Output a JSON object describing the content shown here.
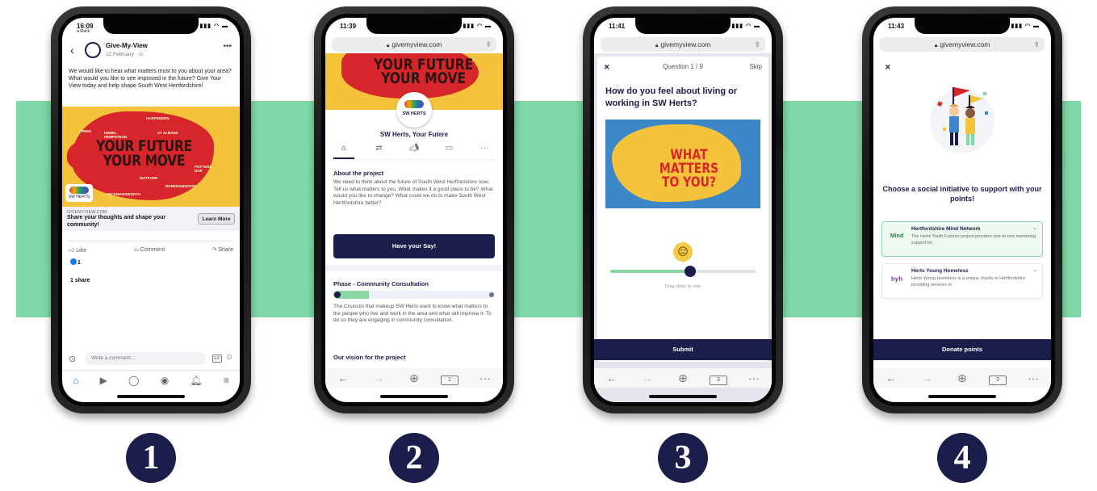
{
  "steps": [
    "1",
    "2",
    "3",
    "4"
  ],
  "phone1": {
    "time": "16:09",
    "back_app": "◂ Slack",
    "page_name": "Give-My-View",
    "post_date": "12 February · ⊙",
    "post_text": "We would like to hear what matters most to you about your area? What would you like to see improved in the future? Give Your View today and help shape South West Hertfordshire!",
    "image_slogan": "YOUR FUTURE\nYOUR MOVE",
    "towns": [
      "TRING",
      "HEMEL HEMPSTEAD",
      "HARPENDEN",
      "ST ALBANS",
      "WATFORD",
      "POTTERS BAR",
      "BOREHAMWOOD",
      "RICKMANSWORTH"
    ],
    "logo_text": "SW HERTS",
    "link_domain": "GIVEMYVIEW.COM",
    "link_title": "Share your thoughts and shape your community!",
    "learn_more": "Learn More",
    "actions": [
      "Like",
      "Comment",
      "Share"
    ],
    "reactions_count": "1",
    "shares": "1 share",
    "comment_placeholder": "Write a comment...",
    "gif_label": "GIF"
  },
  "phone2": {
    "time": "11:39",
    "url": "givemyview.com",
    "banner_slogan": "YOUR FUTURE\nYOUR MOVE",
    "logo_text": "SW HERTS",
    "project_title": "SW Herts, Your Futere",
    "about_heading": "About the project",
    "about_text": "We need to think about the future of South West Hertfordshire now. Tell us what matters to you. What makes it a good place to be? What would you like to change? What could we do to make South West Hertfordshire better?",
    "cta": "Have your Say!",
    "phase_heading": "Phase - Community Consultation",
    "phase_progress": 0.22,
    "phase_text": "The Councils that makeup SW Herts want to know what matters to the people who live and work in the area and what will improve it. To do so they are engaging in community consultation.",
    "vision_heading": "Our vision for the project",
    "tab_count": "1"
  },
  "phone3": {
    "time": "11:41",
    "url": "givemyview.com",
    "close": "✕",
    "question_number": "Question 1 / 9",
    "skip": "Skip",
    "question": "How do you feel about living or working in SW Herts?",
    "image_text": "WHAT MATTERS\nTO YOU?",
    "slider_value": 0.55,
    "slider_hint": "Drag slider to vote",
    "submit": "Submit",
    "tab_count": "3"
  },
  "phone4": {
    "time": "11:43",
    "url": "givemyview.com",
    "close": "✕",
    "heading": "Choose a social initiative to support with your points!",
    "initiatives": [
      {
        "title": "Hertfordshire Mind Network",
        "desc": "The Herts Youth Futures project provides one-to-one mentoring support for",
        "logo": "Mind"
      },
      {
        "title": "Herts Young Homeless",
        "desc": "Herts Young Homeless is a unique charity in Hertfordshire providing services to",
        "logo": "hyh"
      }
    ],
    "donate": "Donate points",
    "tab_count": "3"
  },
  "colors": {
    "navy": "#1b1d4a",
    "band": "#7ed9a6",
    "accent_green": "#8ad6a4",
    "yellow": "#f5c33b",
    "red": "#d6262b",
    "fb_blue": "#1877f2"
  }
}
